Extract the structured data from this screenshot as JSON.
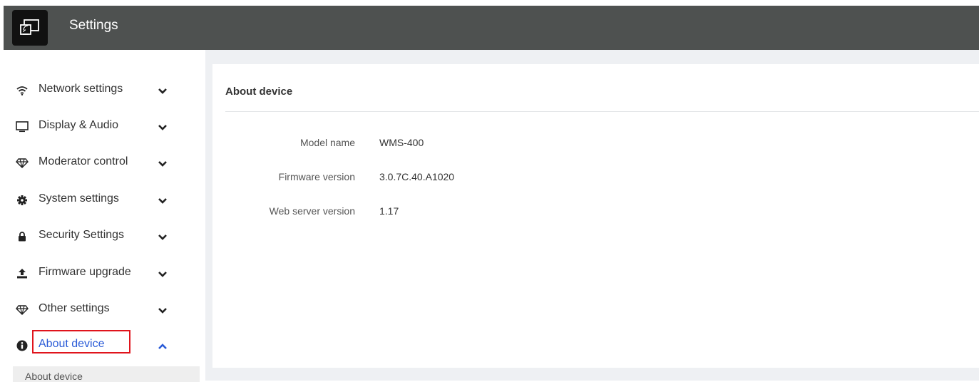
{
  "header": {
    "title": "Settings",
    "logo_icon": "screen-cast-icon"
  },
  "sidebar": {
    "items": [
      {
        "label": "Network settings",
        "icon": "wifi-icon",
        "expanded": false
      },
      {
        "label": "Display & Audio",
        "icon": "monitor-icon",
        "expanded": false
      },
      {
        "label": "Moderator control",
        "icon": "diamond-icon",
        "expanded": false
      },
      {
        "label": "System settings",
        "icon": "gear-icon",
        "expanded": false
      },
      {
        "label": "Security Settings",
        "icon": "lock-icon",
        "expanded": false
      },
      {
        "label": "Firmware upgrade",
        "icon": "upload-icon",
        "expanded": false
      },
      {
        "label": "Other settings",
        "icon": "diamond-icon",
        "expanded": false
      },
      {
        "label": "About device",
        "icon": "info-icon",
        "expanded": true,
        "active": true
      }
    ],
    "subitems": [
      {
        "label": "About device"
      }
    ]
  },
  "main": {
    "title": "About device",
    "fields": [
      {
        "label": "Model name",
        "value": "WMS-400"
      },
      {
        "label": "Firmware version",
        "value": "3.0.7C.40.A1020"
      },
      {
        "label": "Web server version",
        "value": "1.17"
      }
    ]
  },
  "colors": {
    "header_bg": "#4e5150",
    "active_text": "#2a5bd7",
    "highlight_border": "#e0141c",
    "content_bg": "#eef0f3"
  }
}
